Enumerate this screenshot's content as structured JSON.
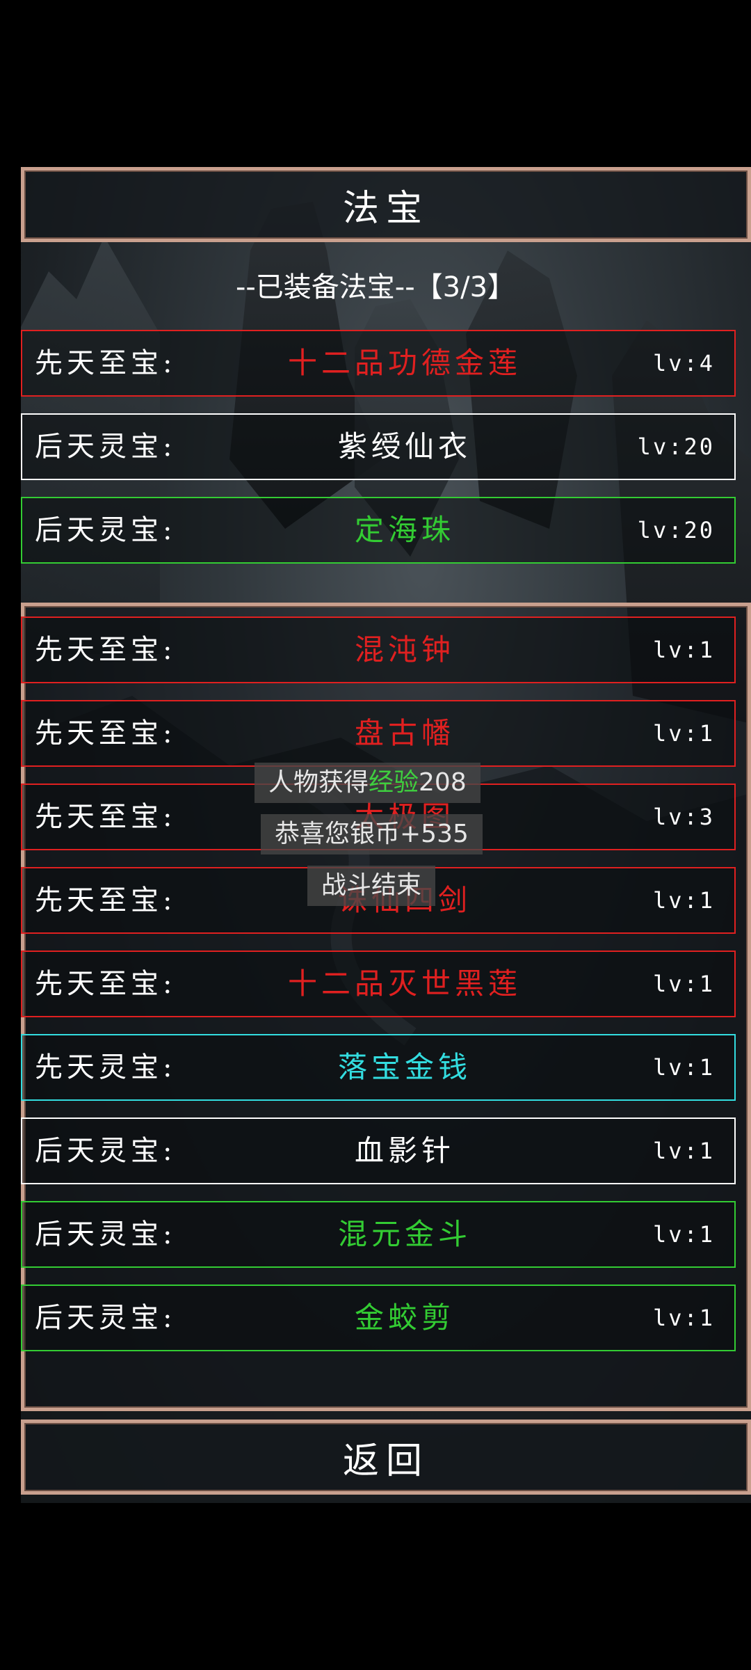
{
  "header": {
    "title": "法宝"
  },
  "equipped": {
    "label": "--已装备法宝--【3/3】",
    "items": [
      {
        "category": "先天至宝:",
        "name": "十二品功德金莲",
        "level": "lv:4",
        "color": "#e02020"
      },
      {
        "category": "后天灵宝:",
        "name": "紫绶仙衣",
        "level": "lv:20",
        "color": "#ffffff"
      },
      {
        "category": "后天灵宝:",
        "name": "定海珠",
        "level": "lv:20",
        "color": "#33cc33"
      }
    ]
  },
  "inventory": {
    "items": [
      {
        "category": "先天至宝:",
        "name": "混沌钟",
        "level": "lv:1",
        "color": "#e02020"
      },
      {
        "category": "先天至宝:",
        "name": "盘古幡",
        "level": "lv:1",
        "color": "#e02020"
      },
      {
        "category": "先天至宝:",
        "name": "太极图",
        "level": "lv:3",
        "color": "#e02020"
      },
      {
        "category": "先天至宝:",
        "name": "诛仙四剑",
        "level": "lv:1",
        "color": "#e02020"
      },
      {
        "category": "先天至宝:",
        "name": "十二品灭世黑莲",
        "level": "lv:1",
        "color": "#e02020"
      },
      {
        "category": "先天灵宝:",
        "name": "落宝金钱",
        "level": "lv:1",
        "color": "#33dde0"
      },
      {
        "category": "后天灵宝:",
        "name": "血影针",
        "level": "lv:1",
        "color": "#ffffff"
      },
      {
        "category": "后天灵宝:",
        "name": "混元金斗",
        "level": "lv:1",
        "color": "#33cc33"
      },
      {
        "category": "后天灵宝:",
        "name": "金蛟剪",
        "level": "lv:1",
        "color": "#33cc33"
      }
    ]
  },
  "toasts": {
    "exp_prefix": "人物获得",
    "exp_highlight": "经验",
    "exp_value": "208",
    "silver": "恭喜您银币+535",
    "battle_end": "战斗结束"
  },
  "footer": {
    "back_label": "返回"
  }
}
